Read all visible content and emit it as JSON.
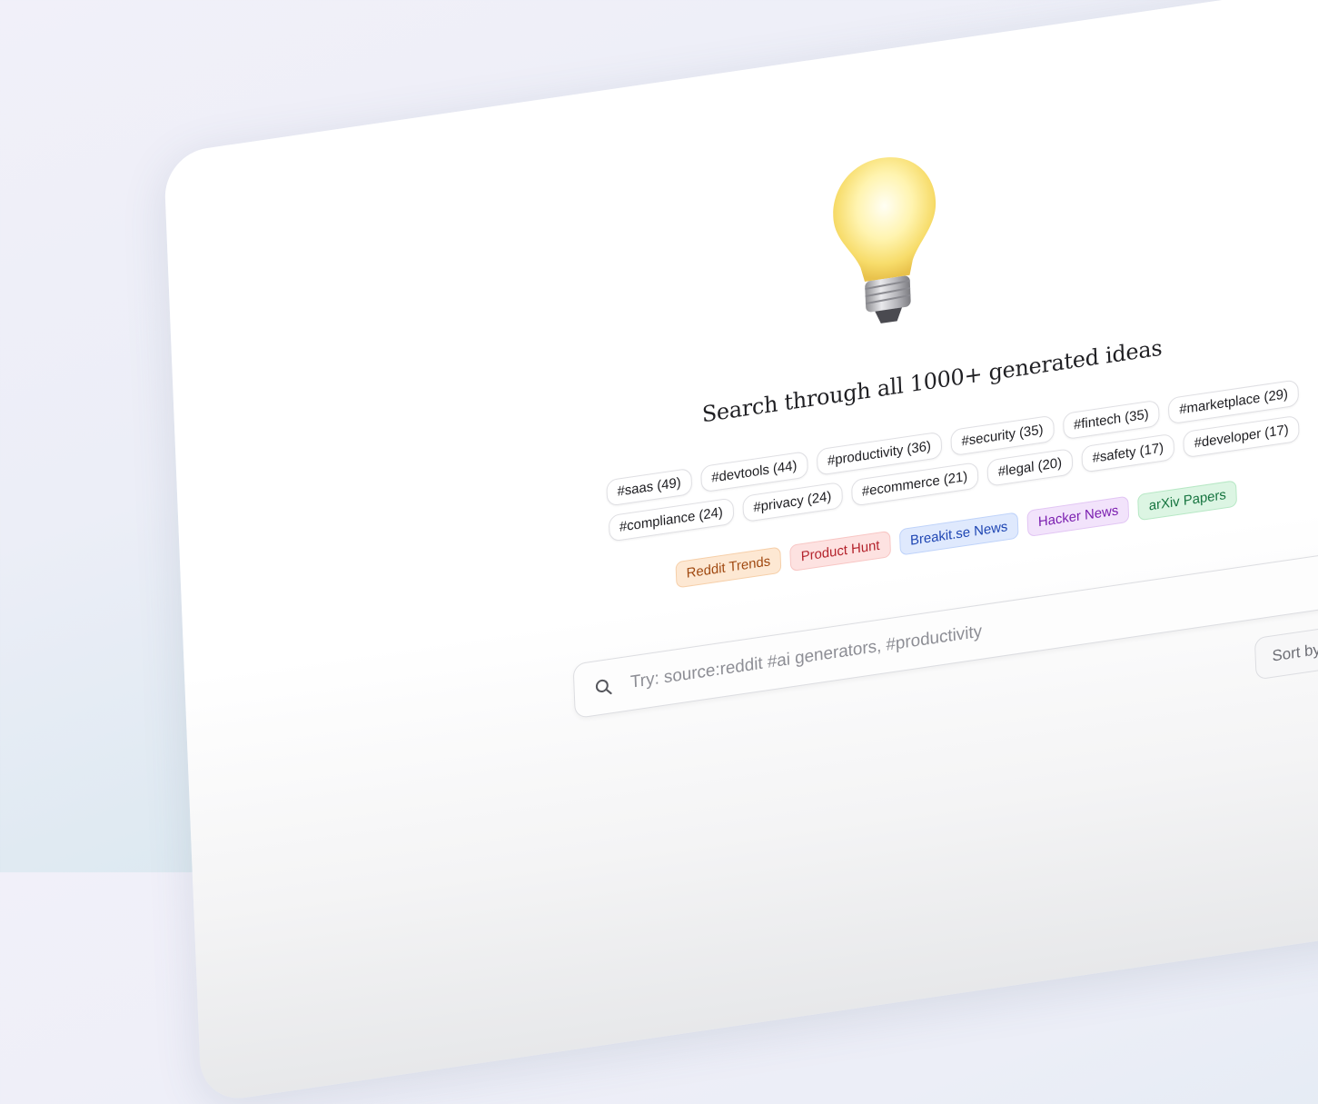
{
  "hero": {
    "icon": "lightbulb-icon",
    "headline": "Search through all 1000+ generated ideas"
  },
  "tag_rows": [
    [
      "#saas (49)",
      "#devtools (44)",
      "#productivity (36)",
      "#security (35)",
      "#fintech (35)",
      "#marketplace (29)"
    ],
    [
      "#compliance (24)",
      "#privacy (24)",
      "#ecommerce (21)",
      "#legal (20)",
      "#safety (17)",
      "#developer (17)"
    ]
  ],
  "sources": [
    {
      "label": "Reddit Trends",
      "bg": "#fde8d3",
      "fg": "#a14a12",
      "border": "#f6cfa9"
    },
    {
      "label": "Product Hunt",
      "bg": "#fde2e1",
      "fg": "#b4232c",
      "border": "#f8c6c4"
    },
    {
      "label": "Breakit.se News",
      "bg": "#dfe9fd",
      "fg": "#1f46b3",
      "border": "#bfd3fa"
    },
    {
      "label": "Hacker News",
      "bg": "#f2e3fb",
      "fg": "#7b1fb0",
      "border": "#e2c6f4"
    },
    {
      "label": "arXiv Papers",
      "bg": "#dcf5e3",
      "fg": "#177540",
      "border": "#b7e8c5"
    }
  ],
  "search": {
    "placeholder": "Try: source:reddit #ai generators, #productivity",
    "icon": "search-icon"
  },
  "sort": {
    "label": "Sort by:"
  }
}
